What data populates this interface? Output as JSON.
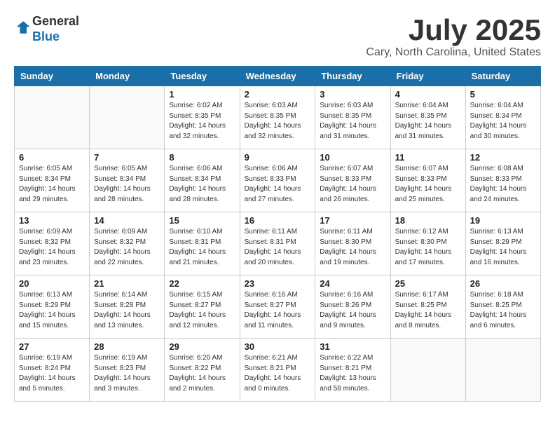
{
  "header": {
    "logo_line1": "General",
    "logo_line2": "Blue",
    "month": "July 2025",
    "location": "Cary, North Carolina, United States"
  },
  "days_of_week": [
    "Sunday",
    "Monday",
    "Tuesday",
    "Wednesday",
    "Thursday",
    "Friday",
    "Saturday"
  ],
  "weeks": [
    [
      {
        "day": "",
        "info": ""
      },
      {
        "day": "",
        "info": ""
      },
      {
        "day": "1",
        "info": "Sunrise: 6:02 AM\nSunset: 8:35 PM\nDaylight: 14 hours and 32 minutes."
      },
      {
        "day": "2",
        "info": "Sunrise: 6:03 AM\nSunset: 8:35 PM\nDaylight: 14 hours and 32 minutes."
      },
      {
        "day": "3",
        "info": "Sunrise: 6:03 AM\nSunset: 8:35 PM\nDaylight: 14 hours and 31 minutes."
      },
      {
        "day": "4",
        "info": "Sunrise: 6:04 AM\nSunset: 8:35 PM\nDaylight: 14 hours and 31 minutes."
      },
      {
        "day": "5",
        "info": "Sunrise: 6:04 AM\nSunset: 8:34 PM\nDaylight: 14 hours and 30 minutes."
      }
    ],
    [
      {
        "day": "6",
        "info": "Sunrise: 6:05 AM\nSunset: 8:34 PM\nDaylight: 14 hours and 29 minutes."
      },
      {
        "day": "7",
        "info": "Sunrise: 6:05 AM\nSunset: 8:34 PM\nDaylight: 14 hours and 28 minutes."
      },
      {
        "day": "8",
        "info": "Sunrise: 6:06 AM\nSunset: 8:34 PM\nDaylight: 14 hours and 28 minutes."
      },
      {
        "day": "9",
        "info": "Sunrise: 6:06 AM\nSunset: 8:33 PM\nDaylight: 14 hours and 27 minutes."
      },
      {
        "day": "10",
        "info": "Sunrise: 6:07 AM\nSunset: 8:33 PM\nDaylight: 14 hours and 26 minutes."
      },
      {
        "day": "11",
        "info": "Sunrise: 6:07 AM\nSunset: 8:33 PM\nDaylight: 14 hours and 25 minutes."
      },
      {
        "day": "12",
        "info": "Sunrise: 6:08 AM\nSunset: 8:33 PM\nDaylight: 14 hours and 24 minutes."
      }
    ],
    [
      {
        "day": "13",
        "info": "Sunrise: 6:09 AM\nSunset: 8:32 PM\nDaylight: 14 hours and 23 minutes."
      },
      {
        "day": "14",
        "info": "Sunrise: 6:09 AM\nSunset: 8:32 PM\nDaylight: 14 hours and 22 minutes."
      },
      {
        "day": "15",
        "info": "Sunrise: 6:10 AM\nSunset: 8:31 PM\nDaylight: 14 hours and 21 minutes."
      },
      {
        "day": "16",
        "info": "Sunrise: 6:11 AM\nSunset: 8:31 PM\nDaylight: 14 hours and 20 minutes."
      },
      {
        "day": "17",
        "info": "Sunrise: 6:11 AM\nSunset: 8:30 PM\nDaylight: 14 hours and 19 minutes."
      },
      {
        "day": "18",
        "info": "Sunrise: 6:12 AM\nSunset: 8:30 PM\nDaylight: 14 hours and 17 minutes."
      },
      {
        "day": "19",
        "info": "Sunrise: 6:13 AM\nSunset: 8:29 PM\nDaylight: 14 hours and 16 minutes."
      }
    ],
    [
      {
        "day": "20",
        "info": "Sunrise: 6:13 AM\nSunset: 8:29 PM\nDaylight: 14 hours and 15 minutes."
      },
      {
        "day": "21",
        "info": "Sunrise: 6:14 AM\nSunset: 8:28 PM\nDaylight: 14 hours and 13 minutes."
      },
      {
        "day": "22",
        "info": "Sunrise: 6:15 AM\nSunset: 8:27 PM\nDaylight: 14 hours and 12 minutes."
      },
      {
        "day": "23",
        "info": "Sunrise: 6:16 AM\nSunset: 8:27 PM\nDaylight: 14 hours and 11 minutes."
      },
      {
        "day": "24",
        "info": "Sunrise: 6:16 AM\nSunset: 8:26 PM\nDaylight: 14 hours and 9 minutes."
      },
      {
        "day": "25",
        "info": "Sunrise: 6:17 AM\nSunset: 8:25 PM\nDaylight: 14 hours and 8 minutes."
      },
      {
        "day": "26",
        "info": "Sunrise: 6:18 AM\nSunset: 8:25 PM\nDaylight: 14 hours and 6 minutes."
      }
    ],
    [
      {
        "day": "27",
        "info": "Sunrise: 6:19 AM\nSunset: 8:24 PM\nDaylight: 14 hours and 5 minutes."
      },
      {
        "day": "28",
        "info": "Sunrise: 6:19 AM\nSunset: 8:23 PM\nDaylight: 14 hours and 3 minutes."
      },
      {
        "day": "29",
        "info": "Sunrise: 6:20 AM\nSunset: 8:22 PM\nDaylight: 14 hours and 2 minutes."
      },
      {
        "day": "30",
        "info": "Sunrise: 6:21 AM\nSunset: 8:21 PM\nDaylight: 14 hours and 0 minutes."
      },
      {
        "day": "31",
        "info": "Sunrise: 6:22 AM\nSunset: 8:21 PM\nDaylight: 13 hours and 58 minutes."
      },
      {
        "day": "",
        "info": ""
      },
      {
        "day": "",
        "info": ""
      }
    ]
  ]
}
